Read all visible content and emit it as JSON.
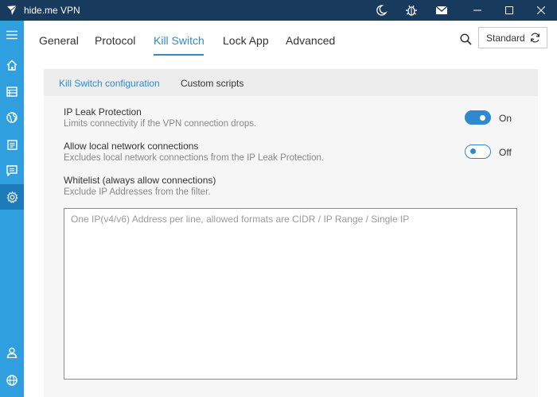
{
  "window": {
    "title": "hide.me VPN",
    "title_bar_icons": [
      "night-mode-icon",
      "bug-report-icon",
      "mail-icon"
    ],
    "controls": [
      "minimize",
      "maximize",
      "close"
    ]
  },
  "sidebar": {
    "items": [
      {
        "name": "menu-icon",
        "active": false
      },
      {
        "name": "home-icon",
        "active": false
      },
      {
        "name": "servers-icon",
        "active": false
      },
      {
        "name": "globe-icon",
        "active": false
      },
      {
        "name": "log-icon",
        "active": false
      },
      {
        "name": "messages-icon",
        "active": false
      },
      {
        "name": "settings-icon",
        "active": true
      },
      {
        "name": "account-icon",
        "active": false
      },
      {
        "name": "language-icon",
        "active": false
      }
    ]
  },
  "tabs": [
    {
      "label": "General",
      "active": false
    },
    {
      "label": "Protocol",
      "active": false
    },
    {
      "label": "Kill Switch",
      "active": true
    },
    {
      "label": "Lock App",
      "active": false
    },
    {
      "label": "Advanced",
      "active": false
    }
  ],
  "mode_button": {
    "label": "Standard"
  },
  "subtabs": [
    {
      "label": "Kill Switch configuration",
      "active": true
    },
    {
      "label": "Custom scripts",
      "active": false
    }
  ],
  "settings": {
    "ip_leak": {
      "title": "IP Leak Protection",
      "description": "Limits connectivity if the VPN connection drops.",
      "state": "On",
      "enabled": true
    },
    "local_network": {
      "title": "Allow local network connections",
      "description": "Excludes local network connections from the IP Leak Protection.",
      "state": "Off",
      "enabled": false
    },
    "whitelist": {
      "title": "Whitelist (always allow connections)",
      "description": "Exclude IP Addresses from the filter.",
      "placeholder": "One IP(v4/v6) Address per line, allowed formats are CIDR / IP Range / Single IP",
      "value": ""
    }
  },
  "colors": {
    "titlebar": "#183a5c",
    "sidebar": "#2f9fe0",
    "sidebar_active": "#1c7bb8",
    "accent": "#2e8ad0"
  }
}
